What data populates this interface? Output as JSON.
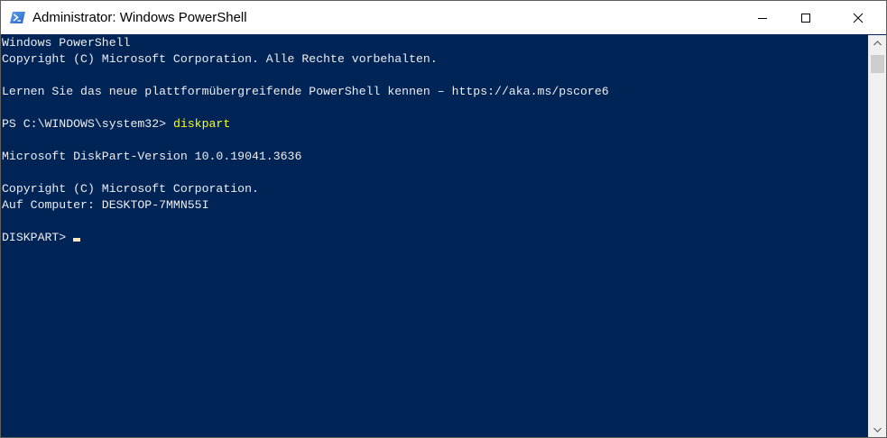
{
  "window": {
    "title": "Administrator: Windows PowerShell",
    "icon": "powershell-icon",
    "controls": {
      "minimize": "minimize-icon",
      "maximize": "maximize-icon",
      "close": "close-icon"
    }
  },
  "console": {
    "lines": [
      "Windows PowerShell",
      "Copyright (C) Microsoft Corporation. Alle Rechte vorbehalten.",
      "",
      "Lernen Sie das neue plattformübergreifende PowerShell kennen – https://aka.ms/pscore6",
      "",
      "PS C:\\WINDOWS\\system32> ",
      "",
      "Microsoft DiskPart-Version 10.0.19041.3636",
      "",
      "Copyright (C) Microsoft Corporation.",
      "Auf Computer: DESKTOP-7MMN55I",
      "",
      "DISKPART>"
    ],
    "command": "diskpart",
    "colors": {
      "background": "#012456",
      "text": "#eeedf0",
      "command": "#ffff00",
      "cursor": "#fbe7c4"
    }
  },
  "scrollbar": {
    "up": "scroll-up-arrow-icon",
    "down": "scroll-down-arrow-icon"
  }
}
